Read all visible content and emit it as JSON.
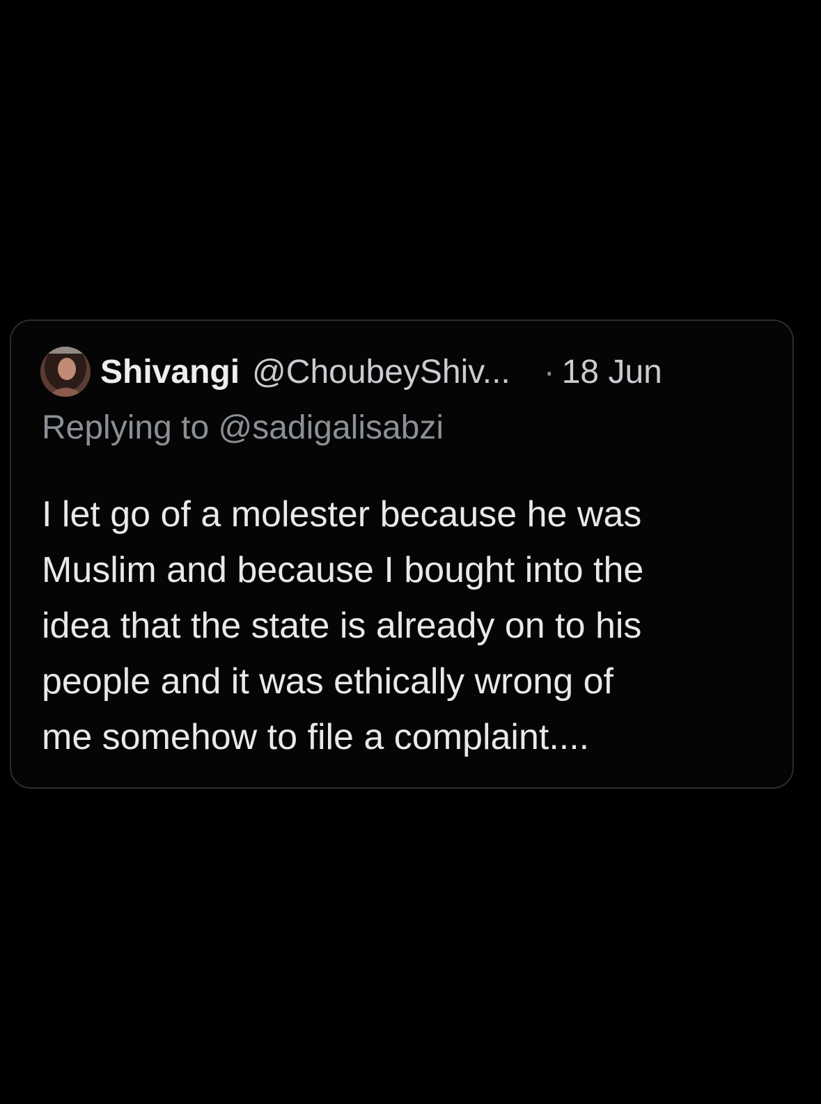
{
  "tweet": {
    "display_name": "Shivangi",
    "handle": "@ChoubeyShiv...",
    "separator": "·",
    "timestamp": "18 Jun",
    "replying_prefix": "Replying to",
    "replying_to": "@sadigalisabzi",
    "body": "I let go of a molester because he was\nMuslim and because I bought into the\nidea that the state is already on to his\npeople and it was ethically wrong of\nme somehow to file a complaint....",
    "avatar_icon": "profile-photo"
  },
  "colors": {
    "background": "#000000",
    "card_border": "#2a2d31",
    "primary_text": "#e7e9ea",
    "secondary_text": "#8b9096"
  }
}
